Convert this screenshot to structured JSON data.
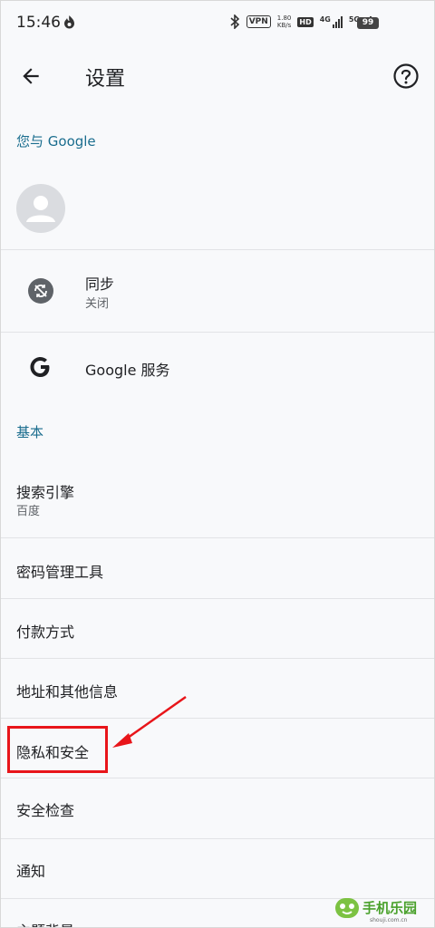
{
  "status_bar": {
    "time": "15:46",
    "vpn": "VPN",
    "speed_value": "1.80",
    "speed_unit": "KB/s",
    "hd": "HD",
    "signal1": "4G",
    "signal2": "5G",
    "battery": "99"
  },
  "toolbar": {
    "title": "设置"
  },
  "sections": {
    "you_and_google": "您与 Google",
    "basics": "基本"
  },
  "account_items": {
    "sync_title": "同步",
    "sync_status": "关闭",
    "google_services": "Google 服务"
  },
  "basic_items": [
    {
      "title": "搜索引擎",
      "subtitle": "百度"
    },
    {
      "title": "密码管理工具"
    },
    {
      "title": "付款方式"
    },
    {
      "title": "地址和其他信息"
    },
    {
      "title": "隐私和安全"
    },
    {
      "title": "安全检查"
    },
    {
      "title": "通知"
    },
    {
      "title": "主题背景"
    }
  ],
  "watermark": {
    "text": "手机乐园",
    "url": "shouji.com.cn"
  },
  "colors": {
    "accent": "#1a6d8e",
    "annotation": "#e8151a",
    "background": "#f8f9fb"
  }
}
